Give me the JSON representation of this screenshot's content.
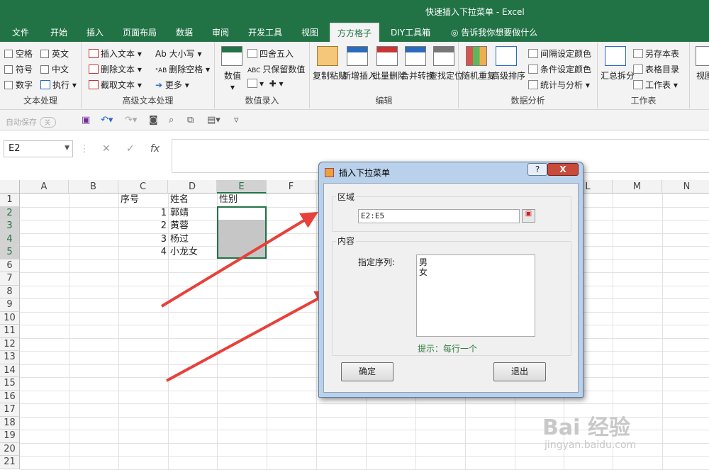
{
  "window": {
    "title": "快速插入下拉菜单 - Excel"
  },
  "tabs": [
    {
      "label": "文件"
    },
    {
      "label": "开始"
    },
    {
      "label": "插入"
    },
    {
      "label": "页面布局"
    },
    {
      "label": "数据"
    },
    {
      "label": "审阅"
    },
    {
      "label": "开发工具"
    },
    {
      "label": "视图"
    },
    {
      "label": "方方格子"
    },
    {
      "label": "DIY工具箱"
    },
    {
      "label": "告诉我你想要做什么"
    }
  ],
  "ribbon": {
    "text_group": {
      "label": "文本处理",
      "items": [
        "空格",
        "英文",
        "符号",
        "中文",
        "数字",
        "执行"
      ]
    },
    "adv_text_group": {
      "label": "高级文本处理",
      "items": [
        "插入文本",
        "大小写",
        "删除文本",
        "删除空格",
        "截取文本",
        "更多"
      ]
    },
    "data_entry_group": {
      "label": "数值录入",
      "value_btn": "数值",
      "items": [
        "四舍五入",
        "只保留数值"
      ]
    },
    "edit_group": {
      "label": "编辑",
      "buttons": [
        "复制粘贴",
        "新增插入",
        "批量删除",
        "合并转换",
        "查找定位"
      ]
    },
    "analysis_group": {
      "label": "数据分析",
      "buttons": [
        "随机重复",
        "高级排序"
      ],
      "items": [
        "间隔设定颜色",
        "条件设定颜色",
        "统计与分析"
      ]
    },
    "worksheet_group": {
      "label": "工作表",
      "button": "汇总拆分",
      "items": [
        "另存本表",
        "表格目录",
        "工作表"
      ],
      "view_label": "视图"
    }
  },
  "qat": {
    "autosave_label": "自动保存",
    "autosave_state": "关"
  },
  "formula_bar": {
    "name_box": "E2",
    "cancel": "✕",
    "enter": "✓",
    "fx": "fx",
    "formula": ""
  },
  "columns": [
    "A",
    "B",
    "C",
    "D",
    "E",
    "F",
    "G",
    "H",
    "I",
    "J",
    "K",
    "L",
    "M",
    "N"
  ],
  "rows": [
    "1",
    "2",
    "3",
    "4",
    "5",
    "6",
    "7",
    "8",
    "9",
    "10",
    "11",
    "12",
    "13",
    "14",
    "15",
    "16",
    "17",
    "18",
    "19",
    "20",
    "21"
  ],
  "cells": {
    "C1": "序号",
    "D1": "姓名",
    "E1": "性别",
    "C2": "1",
    "D2": "郭靖",
    "C3": "2",
    "D3": "黄蓉",
    "C4": "3",
    "D4": "杨过",
    "C5": "4",
    "D5": "小龙女"
  },
  "dialog": {
    "title": "插入下拉菜单",
    "help": "?",
    "close": "X",
    "region_label": "区域",
    "range_value": "E2:E5",
    "content_label": "内容",
    "list_label": "指定序列:",
    "list_items": [
      "男",
      "女"
    ],
    "hint": "提示：每行一个",
    "ok": "确定",
    "exit": "退出"
  },
  "watermark": {
    "logo": "Bai 经验",
    "url": "jingyan.baidu.com"
  },
  "colors": {
    "excel_green": "#217346",
    "arrow_red": "#e8403a"
  }
}
